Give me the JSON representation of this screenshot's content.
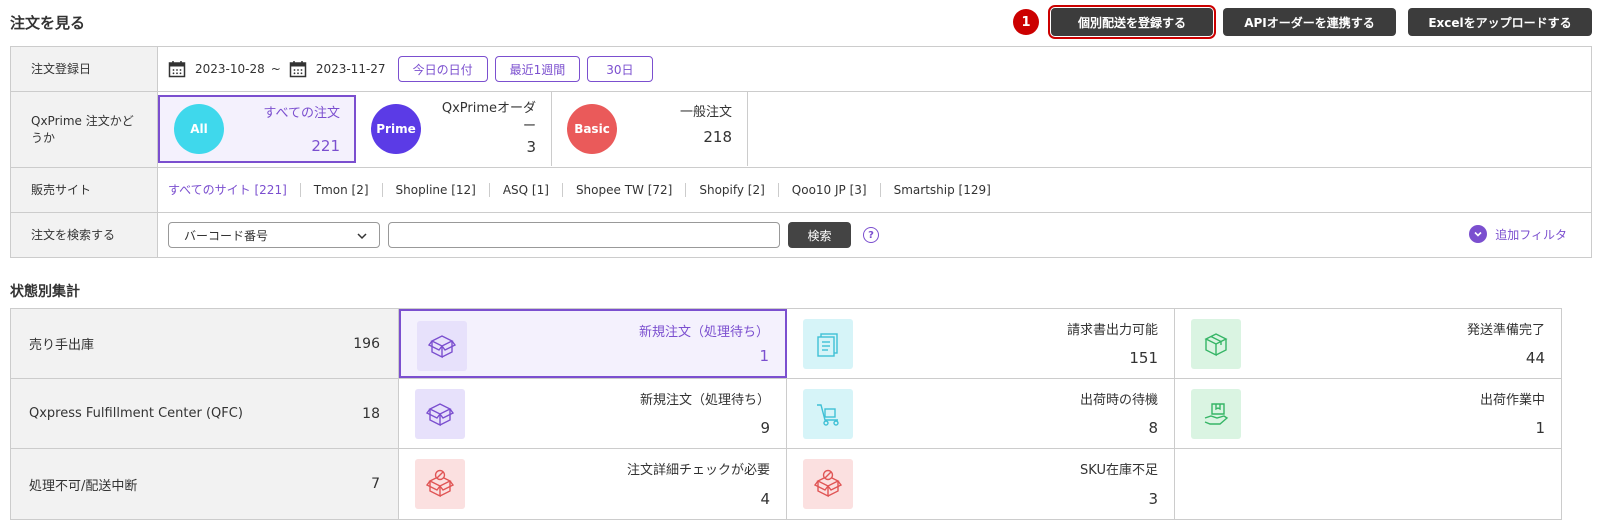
{
  "header": {
    "title": "注文を見る",
    "step_number": "1",
    "btn_register": "個別配送を登録する",
    "btn_api": "APIオーダーを連携する",
    "btn_excel": "Excelをアップロードする"
  },
  "filters": {
    "date": {
      "label": "注文登録日",
      "from": "2023-10-28",
      "separator": "~",
      "to": "2023-11-27",
      "quick": [
        "今日の日付",
        "最近1週間",
        "30日"
      ]
    },
    "prime": {
      "label": "QxPrime 注文かどうか",
      "cards": [
        {
          "circle": "All",
          "label": "すべての注文",
          "count": "221",
          "color": "#3fd8ec"
        },
        {
          "circle": "Prime",
          "label": "QxPrimeオーダー",
          "count": "3",
          "color": "#5b3be6"
        },
        {
          "circle": "Basic",
          "label": "一般注文",
          "count": "218",
          "color": "#ea5a5a"
        }
      ]
    },
    "sites": {
      "label": "販売サイト",
      "items": [
        "すべてのサイト [221]",
        "Tmon [2]",
        "Shopline [12]",
        "ASQ [1]",
        "Shopee TW [72]",
        "Shopify [2]",
        "Qoo10 JP [3]",
        "Smartship [129]"
      ]
    },
    "search": {
      "label": "注文を検索する",
      "select_value": "バーコード番号",
      "button": "検索",
      "help": "?",
      "add_filter": "追加フィルタ"
    }
  },
  "status": {
    "title": "状態別集計",
    "rows": [
      {
        "name": "売り手出庫",
        "count": "196",
        "cells": [
          {
            "label": "新規注文（処理待ち）",
            "value": "1",
            "icon": "box-icon",
            "tint": "violet"
          },
          {
            "label": "請求書出力可能",
            "value": "151",
            "icon": "invoice-icon",
            "tint": "cyan"
          },
          {
            "label": "発送準備完了",
            "value": "44",
            "icon": "package-ready-icon",
            "tint": "green"
          }
        ]
      },
      {
        "name": "Qxpress Fulfillment Center (QFC)",
        "count": "18",
        "cells": [
          {
            "label": "新規注文（処理待ち）",
            "value": "9",
            "icon": "box-icon",
            "tint": "violet"
          },
          {
            "label": "出荷時の待機",
            "value": "8",
            "icon": "cart-icon",
            "tint": "cyan"
          },
          {
            "label": "出荷作業中",
            "value": "1",
            "icon": "shipping-work-icon",
            "tint": "green"
          }
        ]
      },
      {
        "name": "処理不可/配送中断",
        "count": "7",
        "cells": [
          {
            "label": "注文詳細チェックが必要",
            "value": "4",
            "icon": "blocked-box-icon",
            "tint": "pink"
          },
          {
            "label": "SKU在庫不足",
            "value": "3",
            "icon": "blocked-box-icon",
            "tint": "pink"
          }
        ]
      }
    ]
  },
  "colors": {
    "accent": "#7b4fcf",
    "dark_button": "#3c3c3c",
    "highlight_red": "#cc0000"
  }
}
